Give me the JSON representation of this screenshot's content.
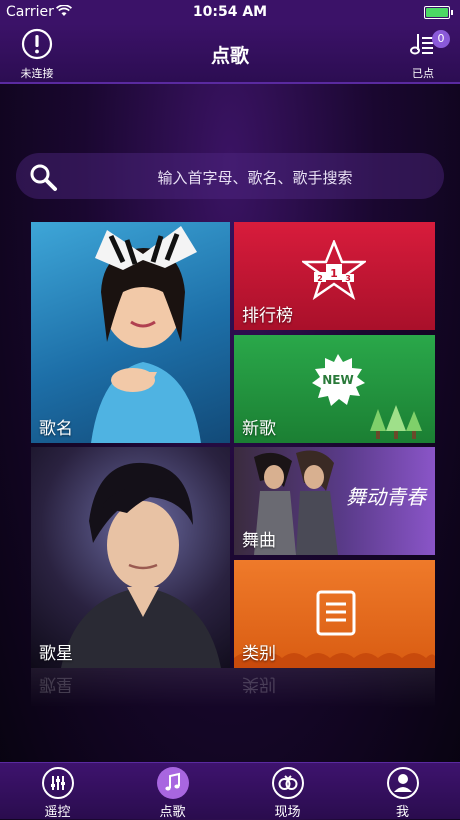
{
  "status_bar": {
    "carrier": "Carrier",
    "time": "10:54 AM",
    "battery_level": 1.0
  },
  "nav": {
    "title": "点歌",
    "left_label": "未连接",
    "right_label": "已点",
    "right_badge": "0"
  },
  "search": {
    "placeholder": "输入首字母、歌名、歌手搜索"
  },
  "tiles": {
    "song_name": "歌名",
    "singer": "歌星",
    "ranking": "排行榜",
    "new_songs": "新歌",
    "new_badge": "NEW",
    "dance": "舞曲",
    "dance_art": "舞动青春",
    "category": "类别"
  },
  "tabs": [
    {
      "label": "遥控",
      "icon": "remote-control-icon"
    },
    {
      "label": "点歌",
      "icon": "music-note-icon",
      "active": true
    },
    {
      "label": "现场",
      "icon": "live-rings-icon"
    },
    {
      "label": "我",
      "icon": "user-icon"
    }
  ],
  "colors": {
    "accent": "#a866e0",
    "nav_bg": "#3b1268",
    "rank_tile": "#d81c3c",
    "new_tile": "#2aa84a",
    "dance_tile": "#8a55c8",
    "category_tile": "#ef7a2a"
  }
}
